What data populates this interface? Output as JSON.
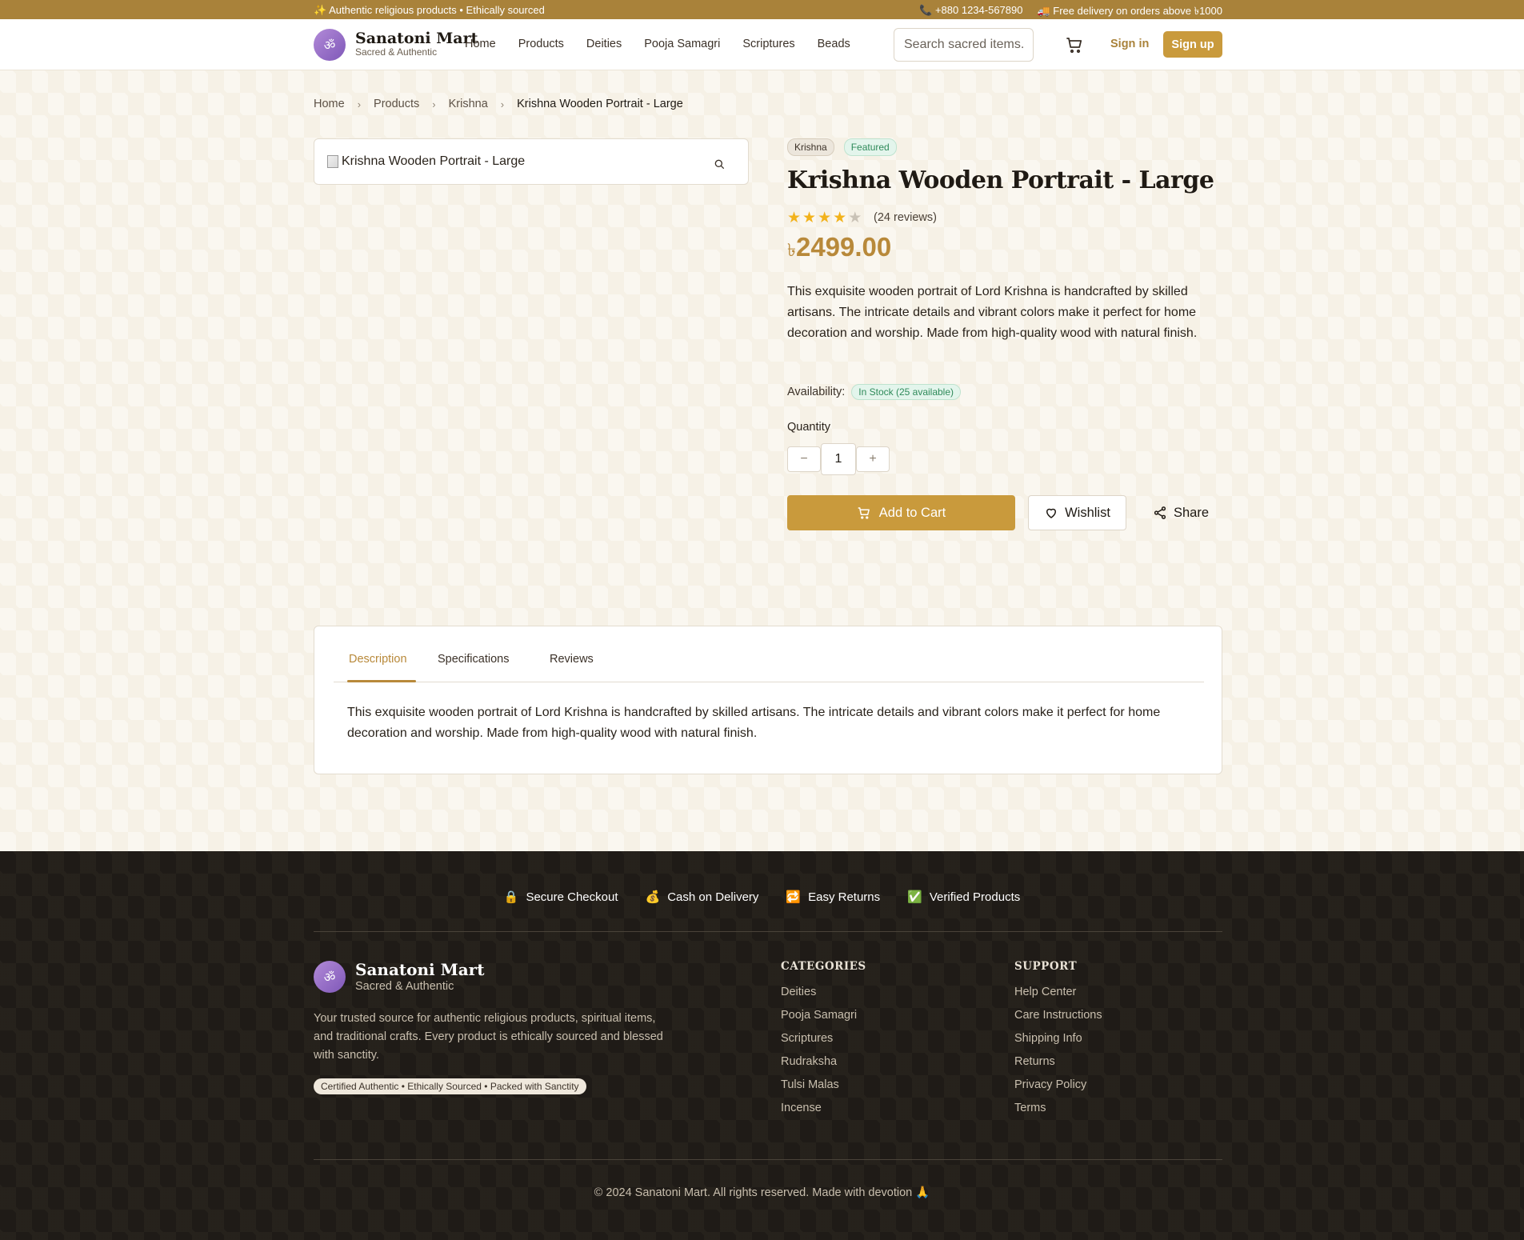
{
  "topbar": {
    "left_text": "✨ Authentic religious products • Ethically sourced",
    "phone": "📞 +880 1234-567890",
    "delivery": "🚚 Free delivery on orders above ৳1000"
  },
  "header": {
    "logo_glyph": "ॐ",
    "brand_name": "Sanatoni Mart",
    "brand_tag": "Sacred & Authentic",
    "nav": [
      "Home",
      "Products",
      "Deities",
      "Pooja Samagri",
      "Scriptures",
      "Beads"
    ],
    "search_placeholder": "Search sacred items...",
    "signin": "Sign in",
    "signup": "Sign up"
  },
  "breadcrumb": [
    "Home",
    "Products",
    "Krishna",
    "Krishna Wooden Portrait - Large"
  ],
  "product": {
    "image_alt": "Krishna Wooden Portrait - Large",
    "badges": [
      "Krishna",
      "Featured"
    ],
    "title": "Krishna Wooden Portrait - Large",
    "rating": 4,
    "rating_max": 5,
    "reviews": "(24 reviews)",
    "currency": "৳",
    "price": "2499.00",
    "description": "This exquisite wooden portrait of Lord Krishna is handcrafted by skilled artisans. The intricate details and vibrant colors make it perfect for home decoration and worship. Made from high-quality wood with natural finish.",
    "availability_label": "Availability:",
    "availability_value": "In Stock (25 available)",
    "quantity_label": "Quantity",
    "quantity": "1",
    "minus": "−",
    "plus": "+",
    "add_to_cart": "Add to Cart",
    "wishlist": "Wishlist",
    "share": "Share"
  },
  "tabs": {
    "items": [
      "Description",
      "Specifications",
      "Reviews"
    ],
    "active": "Description",
    "content": "This exquisite wooden portrait of Lord Krishna is handcrafted by skilled artisans. The intricate details and vibrant colors make it perfect for home decoration and worship. Made from high-quality wood with natural finish."
  },
  "footer": {
    "features": [
      {
        "icon": "🔒",
        "label": "Secure Checkout"
      },
      {
        "icon": "💰",
        "label": "Cash on Delivery"
      },
      {
        "icon": "🔁",
        "label": "Easy Returns"
      },
      {
        "icon": "✅",
        "label": "Verified Products"
      }
    ],
    "brand_name": "Sanatoni Mart",
    "brand_tag": "Sacred & Authentic",
    "about": "Your trusted source for authentic religious products, spiritual items, and traditional crafts. Every product is ethically sourced and blessed with sanctity.",
    "cert": "Certified Authentic • Ethically Sourced • Packed with Sanctity",
    "categories_title": "CATEGORIES",
    "categories": [
      "Deities",
      "Pooja Samagri",
      "Scriptures",
      "Rudraksha",
      "Tulsi Malas",
      "Incense"
    ],
    "support_title": "SUPPORT",
    "support": [
      "Help Center",
      "Care Instructions",
      "Shipping Info",
      "Returns",
      "Privacy Policy",
      "Terms"
    ],
    "copyright": "© 2024 Sanatoni Mart. All rights reserved. Made with devotion 🙏"
  },
  "colors": {
    "accent": "#c99a3c",
    "topbar": "#a9823a",
    "footer_bg": "#1f1b17",
    "success": "#2f8a5a"
  }
}
